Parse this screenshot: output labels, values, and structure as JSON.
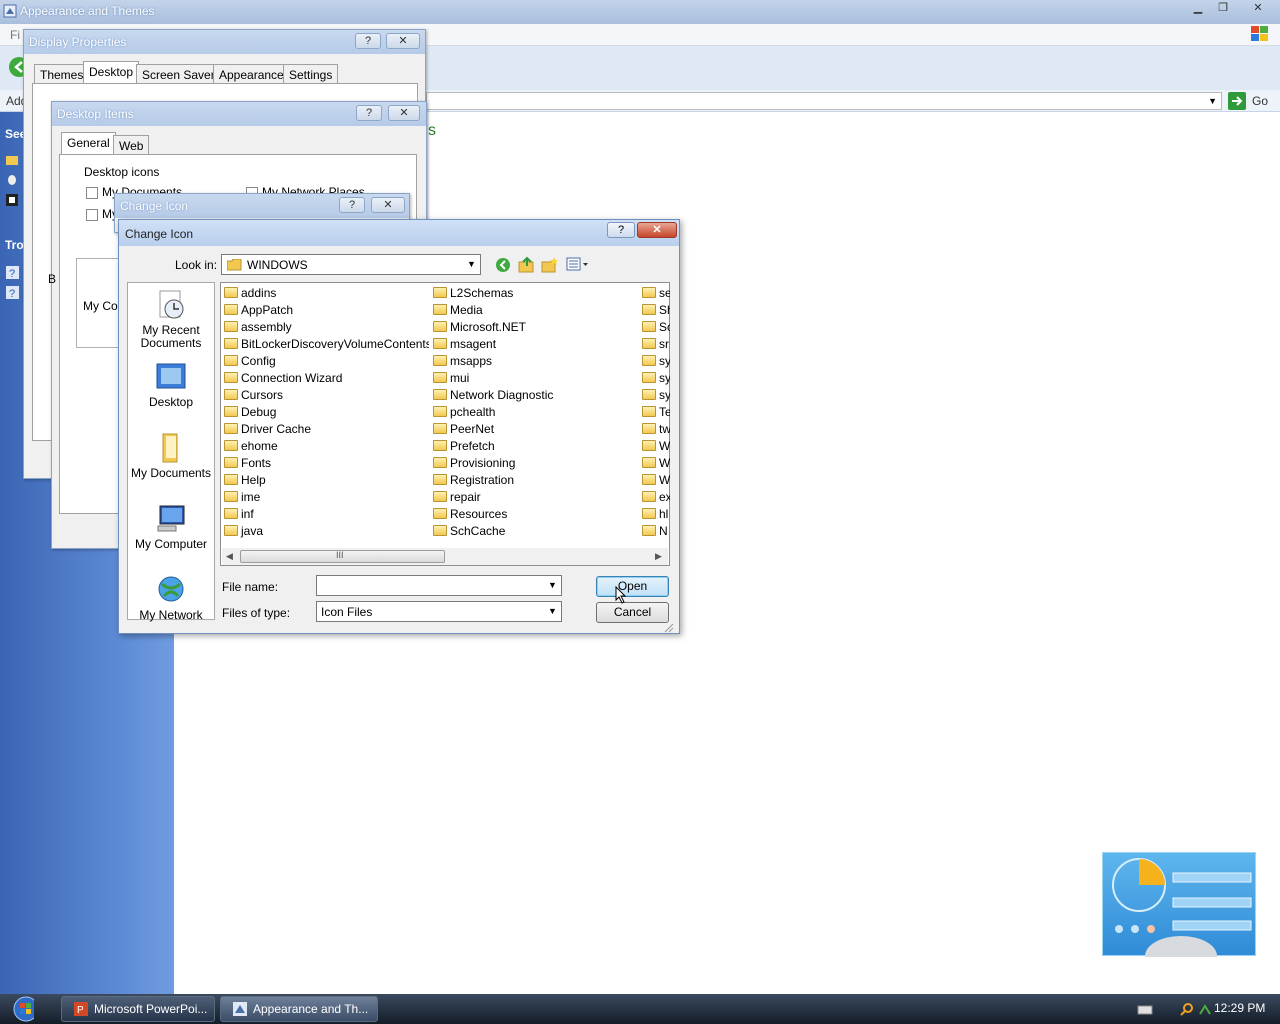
{
  "background_window": {
    "title": "Appearance and Themes",
    "menu_first_letter": "Fi",
    "address_label": "Add",
    "go_label": "Go",
    "sidebar_heading_see": "See",
    "sidebar_heading_tro": "Tro",
    "heading_fragment": "s"
  },
  "display_properties": {
    "title": "Display Properties",
    "help": "?",
    "close": "✕",
    "tabs": [
      "Themes",
      "Desktop",
      "Screen Saver",
      "Appearance",
      "Settings"
    ],
    "active_tab": "Desktop"
  },
  "desktop_items": {
    "title": "Desktop Items",
    "help": "?",
    "close": "✕",
    "tabs": [
      "General",
      "Web"
    ],
    "group_label": "Desktop icons",
    "check_my_documents": "My Documents",
    "check_my_network": "My Network Places",
    "check_my_truncated": "My",
    "icon_label_truncated": "My Co",
    "side_letter": "B"
  },
  "change_icon_bg": {
    "title": "Change Icon",
    "help": "?",
    "close": "✕"
  },
  "open_dialog": {
    "title": "Change Icon",
    "help": "?",
    "close": "✕",
    "look_in_label": "Look in:",
    "look_in_value": "WINDOWS",
    "places": [
      {
        "label": "My Recent Documents",
        "icon": "recent-documents-icon"
      },
      {
        "label": "Desktop",
        "icon": "desktop-icon"
      },
      {
        "label": "My Documents",
        "icon": "my-documents-icon"
      },
      {
        "label": "My Computer",
        "icon": "my-computer-icon"
      },
      {
        "label": "My Network",
        "icon": "my-network-icon"
      }
    ],
    "files_col1": [
      "addins",
      "AppPatch",
      "assembly",
      "BitLockerDiscoveryVolumeContents",
      "Config",
      "Connection Wizard",
      "Cursors",
      "Debug",
      "Driver Cache",
      "ehome",
      "Fonts",
      "Help",
      "ime",
      "inf",
      "java"
    ],
    "files_col2": [
      "L2Schemas",
      "Media",
      "Microsoft.NET",
      "msagent",
      "msapps",
      "mui",
      "Network Diagnostic",
      "pchealth",
      "PeerNet",
      "Prefetch",
      "Provisioning",
      "Registration",
      "repair",
      "Resources",
      "SchCache"
    ],
    "files_col3": [
      "se",
      "Sh",
      "Sc",
      "sr",
      "sy",
      "sy",
      "sy",
      "Te",
      "tw",
      "W",
      "W",
      "W",
      "ex",
      "hl",
      "N"
    ],
    "scroll_grip": "III",
    "file_name_label": "File name:",
    "file_name_value": "",
    "files_of_type_label": "Files of type:",
    "files_of_type_value": "Icon Files",
    "open_button": "Open",
    "cancel_button": "Cancel"
  },
  "taskbar": {
    "tasks": [
      "Microsoft PowerPoi...",
      "Appearance and Th..."
    ],
    "clock": "12:29 PM"
  },
  "colors": {
    "desktop": "#3a6ab8",
    "title_active": "#b9cfec",
    "accent_blue": "#3c7fb1",
    "close_red": "#c7452b",
    "folder_yellow": "#f2c850"
  }
}
